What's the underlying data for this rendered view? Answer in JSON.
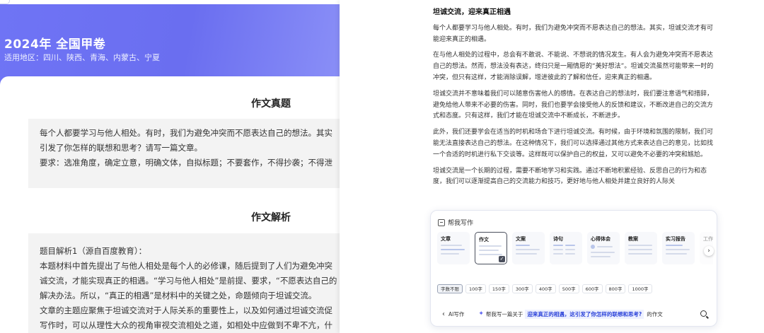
{
  "left": {
    "title": "2024年 全国甲卷",
    "region": "适用地区：四川、陕西、青海、内蒙古、宁夏",
    "section1_title": "作文真题",
    "prompt_lines": [
      "每个人都要学习与他人相处。有时，我们为避免冲突而不愿表达自己的想法。其实",
      "引发了你怎样的联想和思考？请写一篇文章。",
      "要求：选准角度，确定立意，明确文体，自拟标题；不要套作，不得抄袭；不得泄"
    ],
    "section2_title": "作文解析",
    "analysis_lines": [
      "题目解析1（源自百度教育）：",
      "本题材料中首先提出了与他人相处是每个人的必修课，随后提到了人们为避免冲突",
      "诚交流，才能实现真正的相遇。“学习与他人相处”是前提、要求，“不愿表达自己的",
      "解决办法。所以，“真正的相遇”是材料中的关键之处，命题倾向于坦诚交流。",
      "文章的主题应聚焦于坦诚交流对于人际关系的重要性上，以及如何通过坦诚交流促",
      "写作时，可以从理性大众的视角审视交流相处之道，如相处中应做到不卑不亢，什"
    ]
  },
  "article": {
    "title": "坦诚交流，迎来真正相遇",
    "paragraphs": [
      "每个人都要学习与他人相处。有时，我们为避免冲突而不愿表达自己的想法。其实，坦诚交流才有可能迎来真正的相遇。",
      "在与他人相处的过程中，总会有不敢说、不能说、不想说的情况发生。有人会为避免冲突而不愿表达自己的想法。然而，想法没有表达，终归只是一厢情愿的“美好想法”。坦诚交流虽然可能带来一时的冲突，但只有这样，才能消除误解，增进彼此的了解和信任，迎来真正的相遇。",
      "坦诚交流并不意味着我们可以随意伤害他人的感情。在表达自己的想法时，我们要注意语气和措辞，避免给他人带来不必要的伤害。同时，我们也要学会接受他人的反馈和建议，不断改进自己的交流方式和态度。只有这样，我们才能在坦诚交流中不断成长，不断进步。",
      "此外，我们还要学会在适当的时机和场合下进行坦诚交流。有时候，由于环境和氛围的限制，我们可能无法直接表达自己的想法。在这种情况下，我们可以选择通过其他方式来表达自己的意见，比如找一个合适的时机进行私下交谈等。这样既可以保护自己的权益，又可以避免不必要的冲突和尴尬。",
      "坦诚交流是一个长期的过程，需要不断地学习和实践。通过不断地积累经验、反思自己的行为和态度，我们可以逐渐提高自己的交流能力和技巧，更好地与他人相处并建立良好的人际关"
    ]
  },
  "helper": {
    "title": "帮我写作",
    "templates": [
      "文章",
      "作文",
      "文案",
      "诗句",
      "心得体会",
      "教案",
      "实习报告",
      "工作"
    ],
    "selected_template": "作文",
    "word_counts": [
      "字数不限",
      "100字",
      "150字",
      "300字",
      "400字",
      "500字",
      "600字",
      "800字",
      "1000字"
    ],
    "selected_count": "字数不限",
    "back_label": "AI写作",
    "prompt_prefix": "帮我写一篇关于",
    "prompt_topic": "迎来真正的相遇，这引发了你怎样的联想和思考?",
    "prompt_suffix": "的作文"
  },
  "colors": {
    "banner": "#6f74f5",
    "accent": "#5b62f2",
    "highlight_text": "#2c43d9"
  }
}
